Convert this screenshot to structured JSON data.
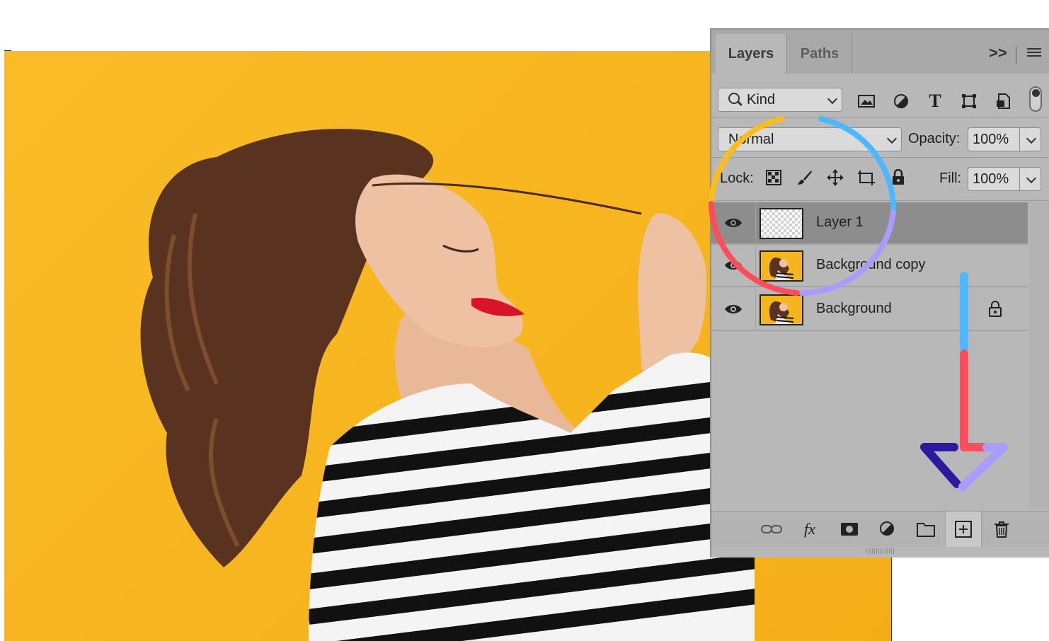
{
  "panel": {
    "tabs": [
      {
        "label": "Layers",
        "active": true
      },
      {
        "label": "Paths",
        "active": false
      }
    ],
    "collapse_glyph": ">>",
    "filter": {
      "kind_label": "Kind",
      "icons": [
        "image-filter-icon",
        "adjustment-filter-icon",
        "type-filter-icon",
        "shape-filter-icon",
        "smart-object-filter-icon"
      ]
    },
    "blend_mode": "Normal",
    "opacity_label": "Opacity:",
    "opacity_value": "100%",
    "lock_label": "Lock:",
    "lock_icons": [
      "lock-transparent-pixels-icon",
      "lock-image-pixels-icon",
      "lock-position-icon",
      "lock-artboard-icon",
      "lock-all-icon"
    ],
    "fill_label": "Fill:",
    "fill_value": "100%",
    "layers": [
      {
        "name": "Layer 1",
        "selected": true,
        "visible": true,
        "thumbnail": "transparent",
        "locked": false
      },
      {
        "name": "Background copy",
        "selected": false,
        "visible": true,
        "thumbnail": "photo",
        "locked": false
      },
      {
        "name": "Background",
        "selected": false,
        "visible": true,
        "thumbnail": "photo",
        "locked": true
      }
    ],
    "toolbar": [
      "link-layers-icon",
      "fx-icon",
      "layer-mask-icon",
      "adjustment-layer-icon",
      "new-group-icon",
      "new-layer-icon",
      "delete-layer-icon"
    ],
    "fx_label": "fx"
  },
  "colors": {
    "canvas_background": "#f7b51f",
    "panel_background": "#b8b8b8",
    "selected_row": "#8d8d8d",
    "annotation_yellow": "#fbbd1e",
    "annotation_blue": "#4db8ff",
    "annotation_purple": "#a99bff",
    "annotation_red": "#ff4d5e",
    "annotation_indigo": "#2b1a9e"
  }
}
